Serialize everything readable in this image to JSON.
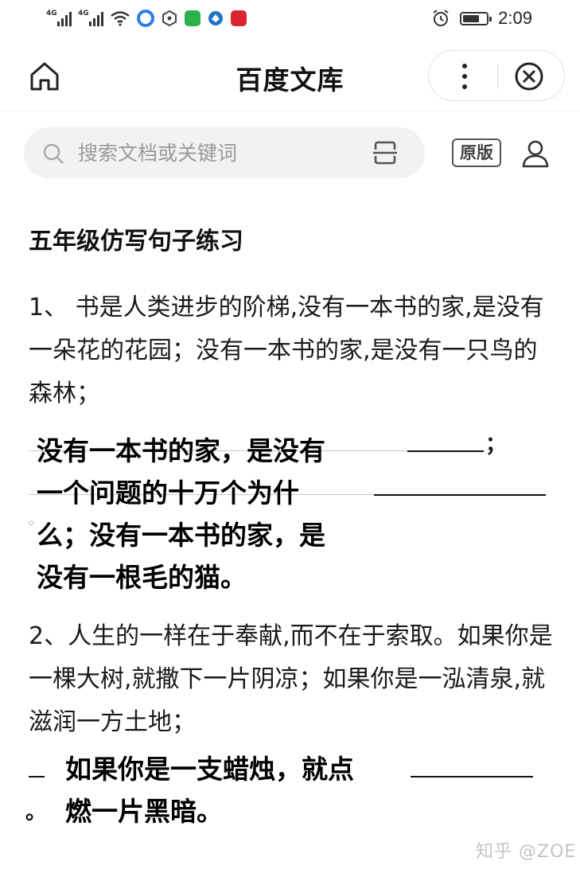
{
  "status_bar": {
    "net1": "4G",
    "net2": "4G",
    "time": "2:09",
    "battery_level": 0.7,
    "icons": [
      "signal-icon",
      "signal-icon",
      "wifi-icon",
      "app-icon",
      "app-icon",
      "app-icon",
      "app-icon",
      "app-icon",
      "alarm-icon",
      "battery-icon"
    ]
  },
  "header": {
    "title": "百度文库"
  },
  "search": {
    "placeholder": "搜索文档或关键词",
    "original_label": "原版"
  },
  "document": {
    "title": "五年级仿写句子练习",
    "item1": "1、 书是人类进步的阶梯,没有一本书的家,是没有一朵花的花园；没有一本书的家,是没有一只鸟的森林；",
    "answer1_lines": [
      "没有一本书的家，是没有",
      "一个问题的十万个为什",
      "么；没有一本书的家，是",
      "没有一根毛的猫。"
    ],
    "answer1_semicolon": "；",
    "answer1_period": "。",
    "item2": "2、人生的一样在于奉献,而不在于索取。如果你是一棵大树,就撒下一片阴凉；如果你是一泓清泉,就滋润一方土地；",
    "answer2_lines": [
      "如果你是一支蜡烛，就点",
      "燃一片黑暗。"
    ],
    "answer2_period": "。"
  },
  "watermark": "知乎 @ZOE",
  "colors": {
    "search_bg": "#f2f2f2",
    "text": "#111111",
    "watermark": "#c4c4c4"
  }
}
